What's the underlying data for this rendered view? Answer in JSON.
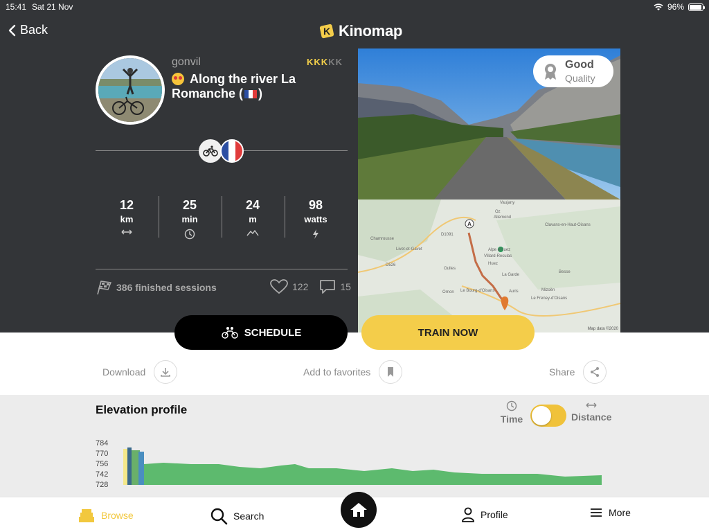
{
  "status_bar": {
    "time": "15:41",
    "date": "Sat 21 Nov",
    "battery": "96%",
    "battery_level": 0.96
  },
  "nav": {
    "back_label": "Back",
    "brand": "Kinomap"
  },
  "video": {
    "author": "gonvil",
    "title_text": "Along the river La Romanche (",
    "title_close": ")",
    "rating": {
      "max": 5,
      "value": 3,
      "glyph": "K"
    },
    "sport_icon": "bike-icon",
    "country_flag": "fr-flag",
    "stats": [
      {
        "value": "12",
        "unit": "km",
        "icon": "arrows-horizontal-icon"
      },
      {
        "value": "25",
        "unit": "min",
        "icon": "clock-icon"
      },
      {
        "value": "24",
        "unit": "m",
        "icon": "mountain-icon"
      },
      {
        "value": "98",
        "unit": "watts",
        "icon": "lightning-icon"
      }
    ],
    "sessions_label": "386 finished sessions",
    "likes": "122",
    "comments": "15",
    "quality": {
      "label": "Good",
      "sub": "Quality"
    }
  },
  "map": {
    "marker_start": "A",
    "credit": "Map data ©2020",
    "places": [
      "Vaujany",
      "Oz",
      "Allemond",
      "Clavans-en-Haut-Oisans",
      "Chamrousse",
      "Livet-et-Gavet",
      "Alpe d'Huez",
      "Villard-Reculas",
      "Huez",
      "Oulles",
      "La Garde",
      "Besse",
      "Ornon",
      "Le Bourg-d'Oisans",
      "Auris",
      "Mizoën",
      "Le Freney-d'Oisans",
      "D1091",
      "D526"
    ]
  },
  "buttons": {
    "schedule": "SCHEDULE",
    "train": "TRAIN NOW"
  },
  "actions": {
    "download": "Download",
    "favorites": "Add to favorites",
    "share": "Share"
  },
  "elevation": {
    "title": "Elevation profile",
    "toggle_left": "Time",
    "toggle_right": "Distance",
    "y_ticks": [
      "784",
      "770",
      "756",
      "742",
      "728"
    ]
  },
  "tabs": {
    "browse": "Browse",
    "search": "Search",
    "profile": "Profile",
    "more": "More"
  },
  "colors": {
    "accent": "#f4cd4a",
    "dark_bg": "#333538",
    "elevation_fill": "#5dba6e"
  }
}
